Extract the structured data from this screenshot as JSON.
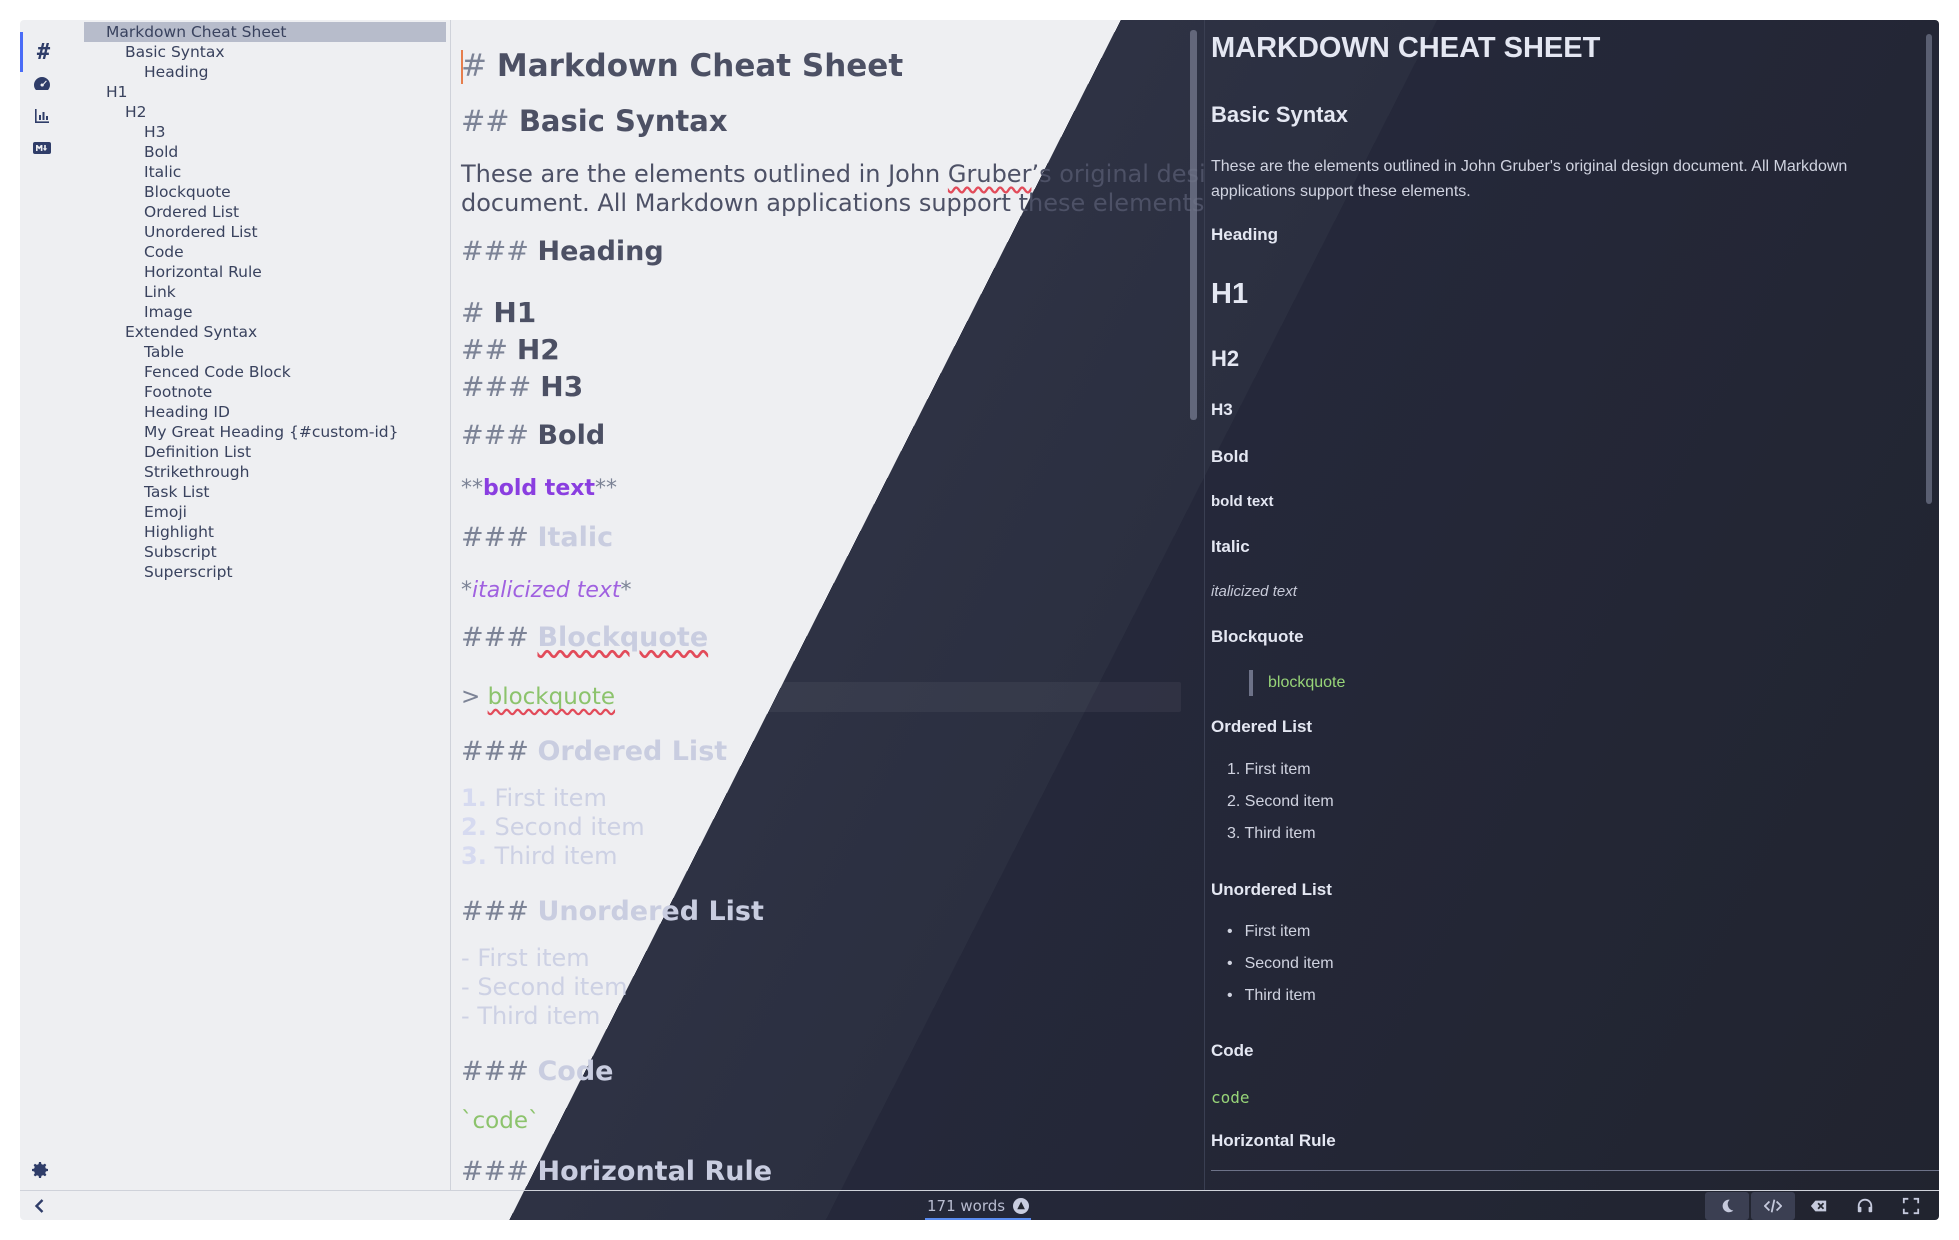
{
  "activity": {
    "items": [
      {
        "name": "outline-tab",
        "icon": "hash-icon",
        "glyph": "#"
      },
      {
        "name": "dashboard-tab",
        "icon": "gauge-icon"
      },
      {
        "name": "chart-tab",
        "icon": "bar-chart-icon"
      },
      {
        "name": "markdown-tab",
        "icon": "markdown-icon"
      }
    ]
  },
  "outline": {
    "items": [
      {
        "label": "Markdown Cheat Sheet",
        "level": 1,
        "selected": true
      },
      {
        "label": "Basic Syntax",
        "level": 2
      },
      {
        "label": "Heading",
        "level": 3
      },
      {
        "label": "H1",
        "level": 1
      },
      {
        "label": "H2",
        "level": 2
      },
      {
        "label": "H3",
        "level": 3
      },
      {
        "label": "Bold",
        "level": 3
      },
      {
        "label": "Italic",
        "level": 3
      },
      {
        "label": "Blockquote",
        "level": 3
      },
      {
        "label": "Ordered List",
        "level": 3
      },
      {
        "label": "Unordered List",
        "level": 3
      },
      {
        "label": "Code",
        "level": 3
      },
      {
        "label": "Horizontal Rule",
        "level": 3
      },
      {
        "label": "Link",
        "level": 3
      },
      {
        "label": "Image",
        "level": 3
      },
      {
        "label": "Extended Syntax",
        "level": 2
      },
      {
        "label": "Table",
        "level": 3
      },
      {
        "label": "Fenced Code Block",
        "level": 3
      },
      {
        "label": "Footnote",
        "level": 3
      },
      {
        "label": "Heading ID",
        "level": 3
      },
      {
        "label": "My Great Heading {#custom-id}",
        "level": 3
      },
      {
        "label": "Definition List",
        "level": 3
      },
      {
        "label": "Strikethrough",
        "level": 3
      },
      {
        "label": "Task List",
        "level": 3
      },
      {
        "label": "Emoji",
        "level": 3
      },
      {
        "label": "Highlight",
        "level": 3
      },
      {
        "label": "Subscript",
        "level": 3
      },
      {
        "label": "Superscript",
        "level": 3
      }
    ]
  },
  "editor": {
    "h1_marker": "#",
    "h2_marker": "##",
    "h3_marker": "###",
    "title": "Markdown Cheat Sheet",
    "basic_syntax": "Basic Syntax",
    "intro_line1_a": "These are the elements outlined in John ",
    "intro_gruber": "Gruber",
    "intro_line1_b": "’s original design",
    "intro_line2": "document. All Markdown applications support these elements.",
    "heading": "Heading",
    "h1": "H1",
    "h2": "H2",
    "h3": "H3",
    "bold_heading": "Bold",
    "bold_marker": "**",
    "bold_text": "bold text",
    "italic_heading": "Italic",
    "italic_marker": "*",
    "italic_text": "italicized text",
    "blockquote_heading": "Blockquote",
    "quote_marker": ">",
    "quote_text": "blockquote",
    "ordered_heading": "Ordered List",
    "ordered_items": [
      "First item",
      "Second item",
      "Third item"
    ],
    "ordered_nums": [
      "1.",
      "2.",
      "3."
    ],
    "unordered_heading": "Unordered List",
    "unordered_marker": "-",
    "unordered_items": [
      "First item",
      "Second item",
      "Third item"
    ],
    "code_heading": "Code",
    "code_text": "`code`",
    "hr_heading": "Horizontal Rule"
  },
  "preview": {
    "title": "MARKDOWN CHEAT SHEET",
    "basic_syntax": "Basic Syntax",
    "intro": "These are the elements outlined in John Gruber's original design document. All Markdown applications support these elements.",
    "heading": "Heading",
    "h1": "H1",
    "h2": "H2",
    "h3": "H3",
    "bold_heading": "Bold",
    "bold_text": "bold text",
    "italic_heading": "Italic",
    "italic_text": "italicized text",
    "blockquote_heading": "Blockquote",
    "quote_text": "blockquote",
    "ordered_heading": "Ordered List",
    "ordered_items": [
      "1. First item",
      "2. Second item",
      "3. Third item"
    ],
    "unordered_heading": "Unordered List",
    "unordered_items": [
      "First item",
      "Second item",
      "Third item"
    ],
    "code_heading": "Code",
    "code_text": "code",
    "hr_heading": "Horizontal Rule"
  },
  "statusbar": {
    "word_count": "171 words",
    "tools": [
      {
        "name": "theme-toggle-button",
        "icon": "moon-icon"
      },
      {
        "name": "source-code-button",
        "icon": "code-icon",
        "active": true
      },
      {
        "name": "clear-button",
        "icon": "backspace-icon"
      },
      {
        "name": "audio-button",
        "icon": "headphones-icon"
      },
      {
        "name": "fullscreen-button",
        "icon": "fullscreen-icon"
      }
    ]
  },
  "colors": {
    "accent": "#4a6cf7",
    "bold_purple": "#8a3ee0",
    "italic_purple": "#a061e0",
    "code_green": "#8cc36c",
    "caret": "#e67e4d"
  }
}
